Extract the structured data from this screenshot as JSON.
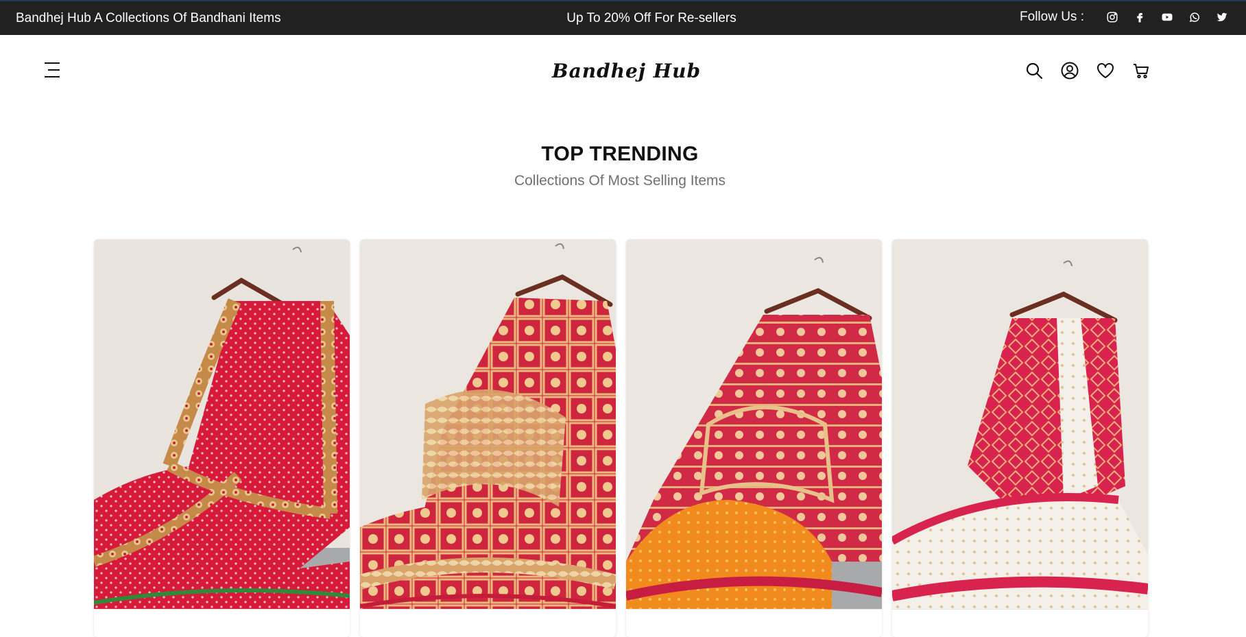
{
  "topbar": {
    "left_text": "Bandhej Hub A Collections Of Bandhani Items",
    "center_text": "Up To 20% Off For Re-sellers",
    "follow_label": "Follow Us :",
    "social": [
      "instagram-icon",
      "facebook-icon",
      "youtube-icon",
      "whatsapp-icon",
      "twitter-icon"
    ]
  },
  "header": {
    "logo": "Bandhej Hub",
    "icons": [
      "search-icon",
      "user-icon",
      "heart-icon",
      "cart-icon"
    ]
  },
  "section": {
    "title": "TOP TRENDING",
    "subtitle": "Collections Of Most Selling Items"
  },
  "products": [
    {
      "image": "red bandhani saree with gold border on hanger"
    },
    {
      "image": "red and gold banarasi bandhani saree on hanger"
    },
    {
      "image": "orange and red bandhani saree on hanger"
    },
    {
      "image": "white and red bandhani saree on hanger"
    }
  ],
  "colors": {
    "topbar_bg": "#212121",
    "background": "#ffffff",
    "subtitle": "#707070"
  }
}
